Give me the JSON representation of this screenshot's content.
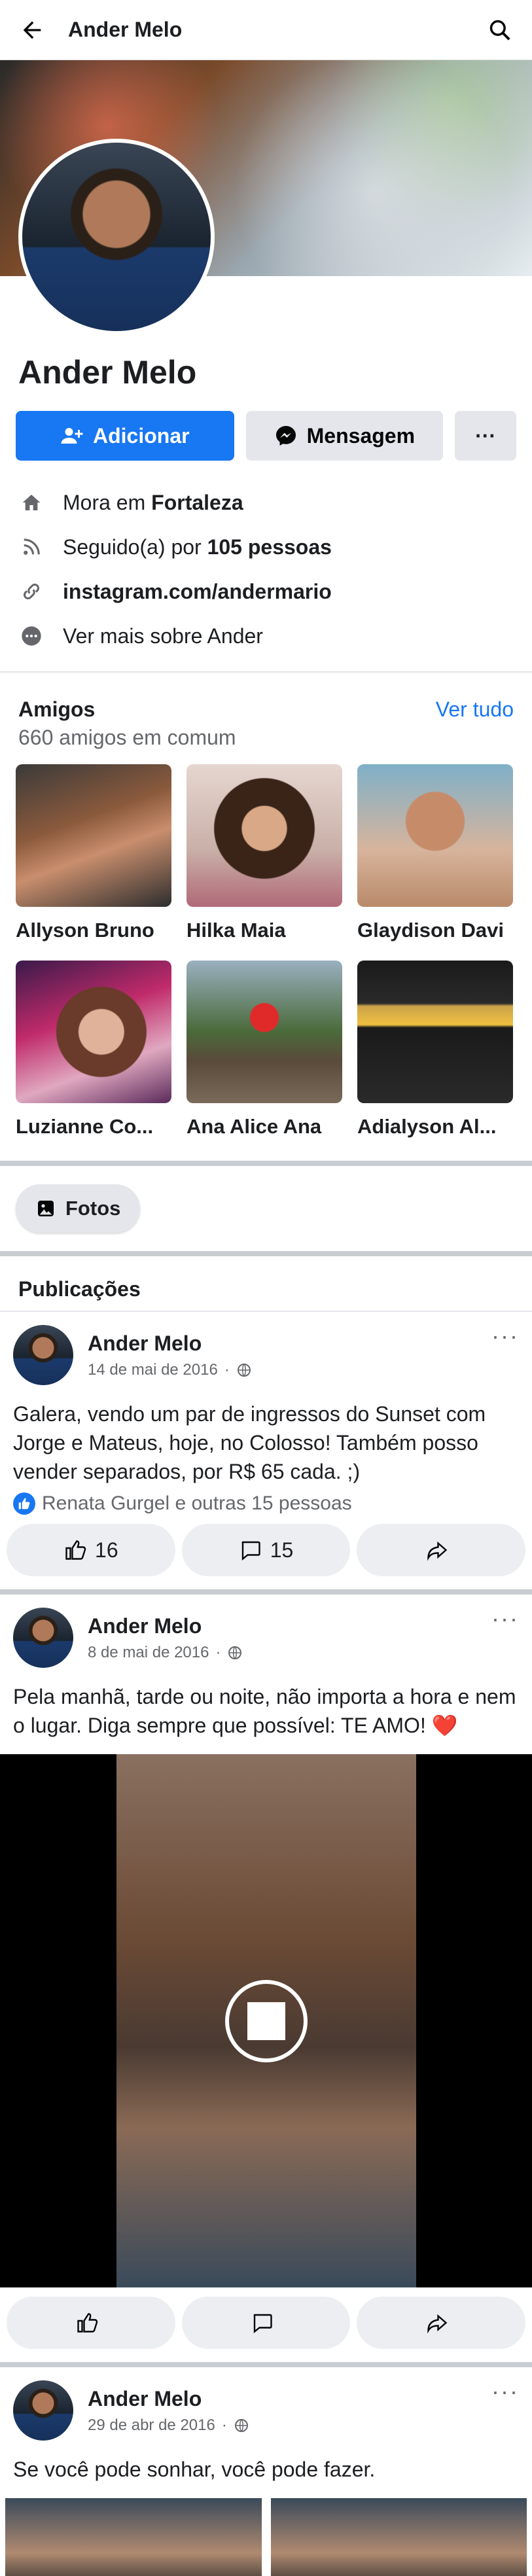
{
  "topbar": {
    "title": "Ander Melo"
  },
  "profile": {
    "name": "Ander Melo",
    "add_label": "Adicionar",
    "message_label": "Mensagem",
    "more_label": "···"
  },
  "info": {
    "lives_prefix": "Mora em ",
    "lives_city": "Fortaleza",
    "followed_prefix": "Seguido(a) por ",
    "followed_count": "105 pessoas",
    "instagram": "instagram.com/andermario",
    "see_more": "Ver mais sobre Ander"
  },
  "friends": {
    "title": "Amigos",
    "subtitle": "660 amigos em comum",
    "see_all": "Ver tudo",
    "items": [
      {
        "name": "Allyson Bruno"
      },
      {
        "name": "Hilka Maia"
      },
      {
        "name": "Glaydison Davi"
      },
      {
        "name": "Luzianne Co..."
      },
      {
        "name": "Ana Alice Ana"
      },
      {
        "name": "Adialyson Al..."
      }
    ]
  },
  "photos": {
    "label": "Fotos"
  },
  "publications": {
    "title": "Publicações"
  },
  "posts": [
    {
      "author": "Ander Melo",
      "date": "14 de mai de 2016",
      "text": "Galera, vendo um par de ingressos do Sunset com Jorge e Mateus, hoje, no Colosso! Também posso vender separados, por R$ 65 cada. ;)",
      "reactions": "Renata Gurgel e outras 15 pessoas",
      "likes": "16",
      "comments": "15"
    },
    {
      "author": "Ander Melo",
      "date": "8 de mai de 2016",
      "text": "Pela manhã, tarde ou noite, não importa a hora e nem o lugar. Diga sempre que possível: TE AMO! ❤️"
    },
    {
      "author": "Ander Melo",
      "date": "29 de abr de 2016",
      "text": "Se você pode sonhar, você pode fazer."
    }
  ]
}
